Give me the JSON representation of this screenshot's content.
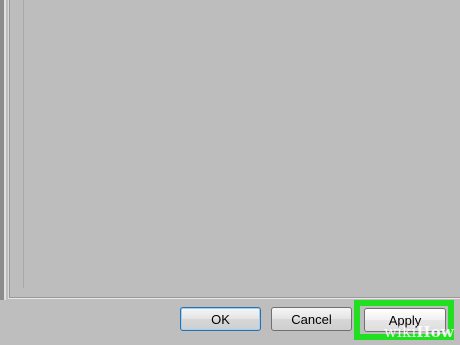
{
  "dialog": {
    "buttons": {
      "ok_label": "OK",
      "cancel_label": "Cancel",
      "apply_label": "Apply"
    },
    "highlight_color": "#21e021",
    "default_button_border": "#2d6fa8"
  },
  "watermark": {
    "wiki": "wiki",
    "how": "How"
  }
}
